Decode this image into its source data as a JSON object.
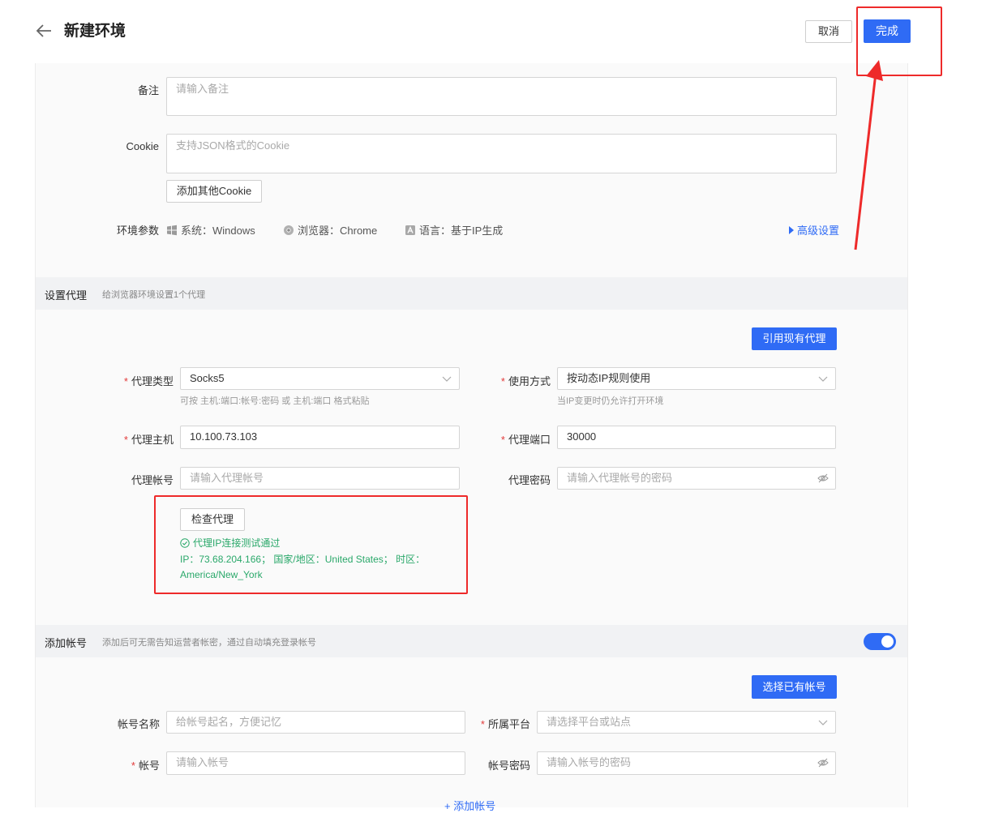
{
  "header": {
    "title": "新建环境",
    "cancel_label": "取消",
    "done_label": "完成"
  },
  "basic": {
    "remark_label": "备注",
    "remark_placeholder": "请输入备注",
    "cookie_label": "Cookie",
    "cookie_placeholder": "支持JSON格式的Cookie",
    "add_cookie_label": "添加其他Cookie",
    "env_params_label": "环境参数",
    "env_system": "系统：Windows",
    "env_browser": "浏览器：Chrome",
    "env_language": "语言：基于IP生成",
    "advanced_label": "高级设置"
  },
  "proxy": {
    "section_title": "设置代理",
    "section_desc": "给浏览器环境设置1个代理",
    "use_existing_label": "引用现有代理",
    "type_label": "代理类型",
    "type_value": "Socks5",
    "type_hint": "可按 主机:端口:帐号:密码 或 主机:端口 格式粘贴",
    "usage_label": "使用方式",
    "usage_value": "按动态IP规则使用",
    "usage_hint": "当IP变更时仍允许打开环境",
    "host_label": "代理主机",
    "host_value": "10.100.73.103",
    "port_label": "代理端口",
    "port_value": "30000",
    "account_label": "代理帐号",
    "account_placeholder": "请输入代理帐号",
    "password_label": "代理密码",
    "password_placeholder": "请输入代理帐号的密码",
    "check_label": "检查代理",
    "check_success": "代理IP连接测试通过",
    "check_result": "IP：73.68.204.166； 国家/地区：United States； 时区：America/New_York"
  },
  "account": {
    "section_title": "添加帐号",
    "section_desc": "添加后可无需告知运营者帐密，通过自动填充登录帐号",
    "select_existing_label": "选择已有帐号",
    "name_label": "帐号名称",
    "name_placeholder": "给帐号起名，方便记忆",
    "platform_label": "所属平台",
    "platform_placeholder": "请选择平台或站点",
    "account_label": "帐号",
    "account_placeholder": "请输入帐号",
    "password_label": "帐号密码",
    "password_placeholder": "请输入帐号的密码",
    "add_account_label": "+ 添加帐号"
  },
  "colors": {
    "primary": "#2f6bf5",
    "success": "#2aa86a",
    "highlight": "#ee2a2a",
    "required": "#e23a3a"
  }
}
